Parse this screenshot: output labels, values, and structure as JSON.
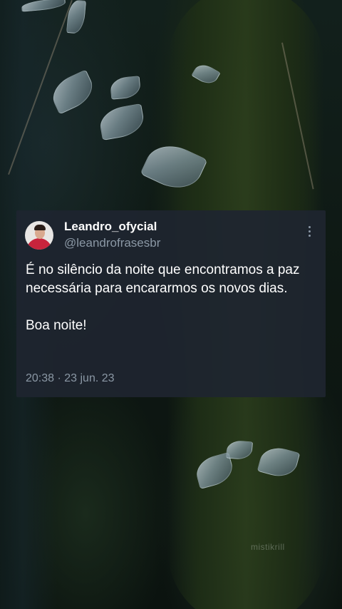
{
  "tweet": {
    "display_name": "Leandro_ofycial",
    "handle": "@leandrofrasesbr",
    "text": "É no silêncio da noite que encontramos a paz necessária para encararmos os novos dias.\n\nBoa noite!",
    "timestamp": "20:38 · 23 jun. 23",
    "more_icon": "more-vertical-icon"
  },
  "watermark": "mistikrill",
  "colors": {
    "card_background": "#1e2530",
    "primary_text": "#ffffff",
    "secondary_text": "#8b98a5",
    "avatar_shirt": "#c8243c"
  }
}
